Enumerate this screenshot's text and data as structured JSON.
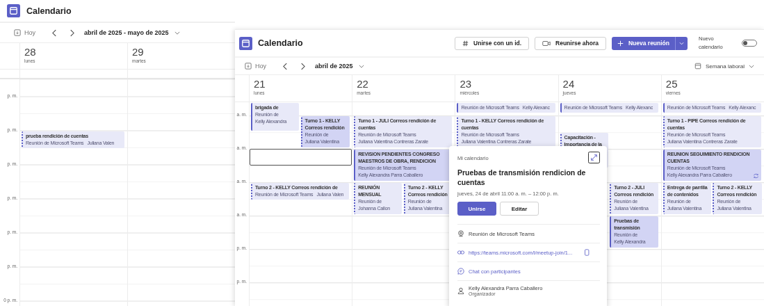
{
  "left_window": {
    "title": "Calendario",
    "toolbar": {
      "today": "Hoy",
      "range": "abril de 2025 - mayo de 2025"
    },
    "time_labels": [
      "p. m.",
      "p. m.",
      "p. m.",
      "p. m.",
      "p. m.",
      "p. m.",
      "0 p. m."
    ],
    "days": [
      {
        "number": "28",
        "weekday": "lunes",
        "events": [
          {
            "title": "prueba rendición de cuentas",
            "type": "Reunión de Microsoft Teams",
            "organizer": "Juliana Valen",
            "accepted": false,
            "highlighted": false,
            "inline": true
          }
        ]
      },
      {
        "number": "29",
        "weekday": "martes"
      }
    ]
  },
  "right_window": {
    "title": "Calendario",
    "actions": [
      {
        "kind": "join_id",
        "label": "Unirse con un id.",
        "primary": false
      },
      {
        "kind": "meet_now",
        "label": "Reunirse ahora",
        "primary": false
      },
      {
        "kind": "new_meeting",
        "label": "Nueva reunión",
        "primary": true
      }
    ],
    "new_calendar": {
      "label": "Nuevo calendario",
      "on": false
    },
    "toolbar": {
      "today": "Hoy",
      "range": "abril de 2025",
      "view": "Semana laboral"
    },
    "time_labels": [
      "a. m.",
      "a. m.",
      "a. m.",
      "a. m.",
      "p. m.",
      "p. m."
    ],
    "days": [
      {
        "number": "21",
        "weekday": "lunes",
        "slot_selected": true,
        "events": [
          {
            "title": "brigada de",
            "type": "Reunión de",
            "organizer": "Kelly Alexandra",
            "accepted": true,
            "highlighted": false,
            "inline": false
          },
          {
            "title": "Turno 1 - KELLY Correos rendición",
            "type": "Reunión de",
            "organizer": "Juliana Valentina",
            "accepted": false,
            "highlighted": true,
            "inline": false
          },
          {
            "title": "Turno 2 - KELLY Correos rendición de",
            "type": "Reunión de Microsoft Teams",
            "organizer": "Juliana Valen",
            "accepted": false,
            "highlighted": false,
            "inline": true
          }
        ]
      },
      {
        "number": "22",
        "weekday": "martes",
        "events": [
          {
            "title": "Turno 1 - JULI Correos rendición de cuentas",
            "type": "Reunión de Microsoft Teams",
            "organizer": "Juliana Valentina Contreras Zarate",
            "accepted": false,
            "highlighted": false,
            "inline": false
          },
          {
            "title": "REVISION PENDIENTES CONGRESO MAESTROS DE OBRA, RENDICION",
            "type": "Reunión de Microsoft Teams",
            "organizer": "Kelly Alexandra Parra Caballero",
            "accepted": true,
            "highlighted": true,
            "inline": false
          },
          {
            "title": "REUNIÓN MENSUAL",
            "type": "Reunión de",
            "organizer": "Johanna Callon",
            "accepted": false,
            "highlighted": false,
            "inline": false
          },
          {
            "title": "Turno 2 - KELLY Correos rendición",
            "type": "Reunión de",
            "organizer": "Juliana Valentina",
            "accepted": false,
            "highlighted": false,
            "inline": false
          }
        ]
      },
      {
        "number": "23",
        "weekday": "miércoles",
        "events": [
          {
            "type": "Reunión de Microsoft Teams",
            "organizer": "Kelly Alexanc",
            "accepted": true,
            "highlighted": false,
            "inline": true
          },
          {
            "title": "Turno 1 - KELLY Correos rendición de cuentas",
            "type": "Reunión de Microsoft Teams",
            "organizer": "Juliana Valentina Contreras Zarate",
            "accepted": false,
            "highlighted": false,
            "inline": false
          }
        ]
      },
      {
        "number": "24",
        "weekday": "jueves",
        "events": [
          {
            "type": "Reunión de Microsoft Teams",
            "organizer": "Kelly Alexanc",
            "accepted": true,
            "highlighted": false,
            "inline": true
          },
          {
            "title": "Capacitación - Importancia de la",
            "accepted": false,
            "highlighted": false
          },
          {
            "title": "Turno 2 - JULI Correos rendición",
            "type": "Reunión de",
            "organizer": "Juliana Valentina",
            "accepted": false,
            "highlighted": false,
            "inline": false
          },
          {
            "title": "Pruebas de transmisión",
            "type": "Reunión de",
            "organizer": "Kelly Alexandra",
            "accepted": true,
            "highlighted": true,
            "inline": false
          }
        ]
      },
      {
        "number": "25",
        "weekday": "viernes",
        "events": [
          {
            "type": "Reunión de Microsoft Teams",
            "organizer": "Kelly Alexanc",
            "accepted": true,
            "highlighted": false,
            "inline": true
          },
          {
            "title": "Turno 1 - PIPE Correos rendición de cuentas",
            "type": "Reunión de Microsoft Teams",
            "organizer": "Juliana Valentina Contreras Zarate",
            "accepted": false,
            "highlighted": false,
            "inline": false
          },
          {
            "title": "REUNION SEGUIMIENTO RENDICION CUENTAS",
            "type": "Reunión de Microsoft Teams",
            "organizer": "Kelly Alexandra Parra Caballero",
            "accepted": true,
            "highlighted": true,
            "inline": false,
            "recurring": true
          },
          {
            "title": "Entrega de parrilla de contenidos",
            "type": "Reunión de",
            "organizer": "Juliana Valentina",
            "accepted": false,
            "highlighted": false,
            "inline": false
          },
          {
            "title": "Turno 2 - KELLY Correos rendición",
            "type": "Reunión de",
            "organizer": "Juliana Valentina",
            "accepted": false,
            "highlighted": false,
            "inline": false
          }
        ]
      }
    ],
    "popup": {
      "calendar": "Mi calendario",
      "title": "Pruebas de transmisión rendicion de cuentas",
      "when": "jueves, 24 de abril 11:00 a. m. – 12:00 p. m.",
      "buttons": [
        {
          "label": "Unirse",
          "primary": true
        },
        {
          "label": "Editar",
          "primary": false
        }
      ],
      "details": [
        {
          "kind": "location",
          "text": "Reunión de Microsoft Teams"
        },
        {
          "kind": "link",
          "text": "https://teams.microsoft.com/l/meetup-join/1..."
        },
        {
          "kind": "chat",
          "text": "Chat con participantes"
        },
        {
          "kind": "organizer",
          "text": "Kelly Alexandra Parra Caballero",
          "role": "Organizador"
        }
      ]
    }
  }
}
